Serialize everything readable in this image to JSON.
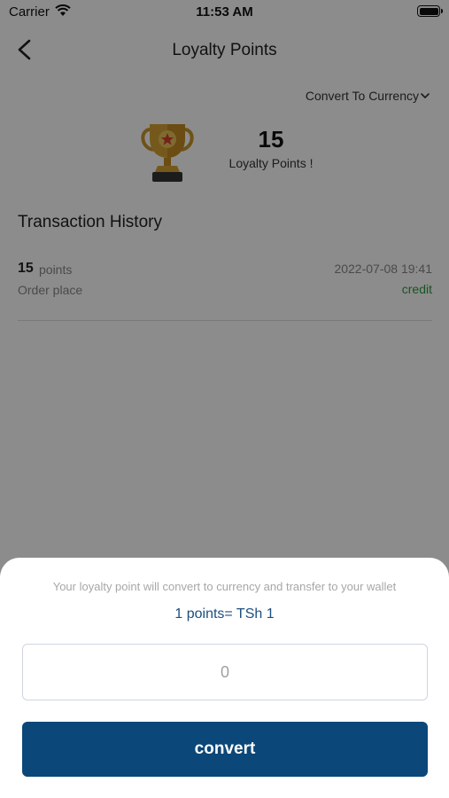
{
  "status_bar": {
    "carrier": "Carrier",
    "time": "11:53 AM"
  },
  "nav": {
    "title": "Loyalty Points",
    "back_icon": "chevron-left-icon"
  },
  "convert_dropdown": {
    "label": "Convert To Currency",
    "icon": "chevron-down-icon"
  },
  "summary": {
    "points": "15",
    "label": "Loyalty Points !",
    "icon": "trophy-icon"
  },
  "history": {
    "title": "Transaction History",
    "items": [
      {
        "points": "15",
        "unit": "points",
        "date": "2022-07-08 19:41",
        "description": "Order place",
        "type": "credit"
      }
    ]
  },
  "sheet": {
    "note": "Your loyalty point will convert to currency and transfer to your wallet",
    "rate": "1 points= TSh 1",
    "input_placeholder": "0",
    "convert_label": "convert"
  },
  "colors": {
    "primary": "#0b4778",
    "rate_text": "#1c4f7e",
    "credit": "#2f9a3f",
    "trophy": "#c9952a"
  }
}
